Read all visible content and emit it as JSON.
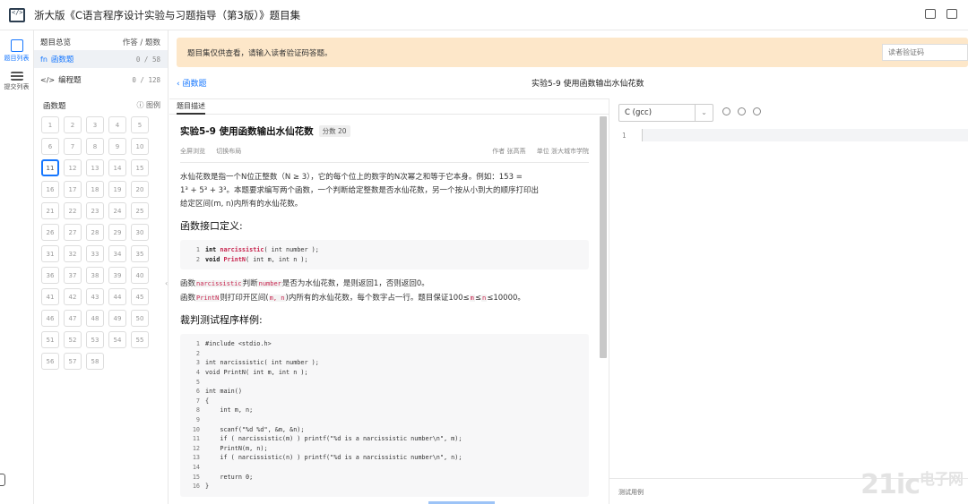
{
  "app": {
    "title": "浙大版《C语言程序设计实验与习题指导（第3版）》题目集"
  },
  "rail": {
    "items": [
      {
        "label": "题目列表",
        "icon": "edit-list-icon",
        "active": true
      },
      {
        "label": "提交列表",
        "icon": "list-icon",
        "active": false
      }
    ]
  },
  "sidebar": {
    "overview_label": "题目总览",
    "overview_right": "作答 / 题数",
    "rows": [
      {
        "icon": "fn",
        "label": "函数题",
        "count": "0 / 58",
        "active": true
      },
      {
        "icon": "</>",
        "label": "编程题",
        "count": "0 / 128",
        "active": false
      }
    ],
    "section_label": "函数题",
    "legend_label": "图例",
    "numbers": [
      "1",
      "2",
      "3",
      "4",
      "5",
      "6",
      "7",
      "8",
      "9",
      "10",
      "11",
      "12",
      "13",
      "14",
      "15",
      "16",
      "17",
      "18",
      "19",
      "20",
      "21",
      "22",
      "23",
      "24",
      "25",
      "26",
      "27",
      "28",
      "29",
      "30",
      "31",
      "32",
      "33",
      "34",
      "35",
      "36",
      "37",
      "38",
      "39",
      "40",
      "41",
      "42",
      "43",
      "44",
      "45",
      "46",
      "47",
      "48",
      "49",
      "50",
      "51",
      "52",
      "53",
      "54",
      "55",
      "56",
      "57",
      "58"
    ],
    "selected": "11"
  },
  "notice": {
    "text": "题目集仅供查看，请输入读者验证码答题。",
    "input_placeholder": "读者验证码"
  },
  "nav": {
    "back_label": "函数题",
    "problem_title": "实验5-9 使用函数输出水仙花数"
  },
  "left_tab": "题目描述",
  "problem": {
    "title": "实验5-9 使用函数输出水仙花数",
    "score": "分数 20",
    "fullscreen": "全屏浏览",
    "switch_layout": "切换布局",
    "author": "作者 张高燕",
    "unit": "单位 浙大城市学院",
    "desc_line1": "水仙花数是指一个N位正整数（N ≥ 3），它的每个位上的数字的N次幂之和等于它本身。例如：153 =",
    "desc_line2": "1³ + 5³ + 3³。本题要求编写两个函数，一个判断给定整数是否水仙花数，另一个按从小到大的顺序打印出",
    "desc_line3": "给定区间(m, n)内所有的水仙花数。",
    "interface_heading": "函数接口定义:",
    "interface_code": [
      {
        "n": "1",
        "pre": "int ",
        "fn": "narcissistic",
        "post": "( int number );"
      },
      {
        "n": "2",
        "pre": "void ",
        "fn": "PrintN",
        "post": "( int m, int n );"
      }
    ],
    "func1_a": "函数",
    "func1_code": "narcissistic",
    "func1_b": "判断",
    "func1_code2": "number",
    "func1_c": "是否为水仙花数，是则返回1，否则返回0。",
    "func2_a": "函数",
    "func2_code": "PrintN",
    "func2_b": "则打印开区间(",
    "func2_code2": "m, n",
    "func2_c": ")内所有的水仙花数，每个数字占一行。题目保证100≤",
    "func2_code3": "m",
    "func2_d": "≤",
    "func2_code4": "n",
    "func2_e": "≤10000。",
    "sample_heading": "裁判测试程序样例:",
    "sample_code": [
      {
        "n": "1",
        "t": "#include <stdio.h>"
      },
      {
        "n": "2",
        "t": ""
      },
      {
        "n": "3",
        "t": "int narcissistic( int number );"
      },
      {
        "n": "4",
        "t": "void PrintN( int m, int n );"
      },
      {
        "n": "5",
        "t": ""
      },
      {
        "n": "6",
        "t": "int main()"
      },
      {
        "n": "7",
        "t": "{"
      },
      {
        "n": "8",
        "t": "    int m, n;"
      },
      {
        "n": "9",
        "t": ""
      },
      {
        "n": "10",
        "t": "    scanf(\"%d %d\", &m, &n);"
      },
      {
        "n": "11",
        "t": "    if ( narcissistic(m) ) printf(\"%d is a narcissistic number\\n\", m);"
      },
      {
        "n": "12",
        "t": "    PrintN(m, n);"
      },
      {
        "n": "13",
        "t": "    if ( narcissistic(n) ) printf(\"%d is a narcissistic number\\n\", n);"
      },
      {
        "n": "14",
        "t": ""
      },
      {
        "n": "15",
        "t": "    return 0;"
      },
      {
        "n": "16",
        "t": "}"
      }
    ]
  },
  "editor": {
    "language": "C (gcc)",
    "first_line": "1",
    "tests_label": "测试用例"
  },
  "watermark": {
    "main": "21ic",
    "small": "电子网"
  },
  "colors": {
    "accent": "#1677ff",
    "notice_bg": "#fde7c9",
    "code_red": "#c7254e"
  }
}
